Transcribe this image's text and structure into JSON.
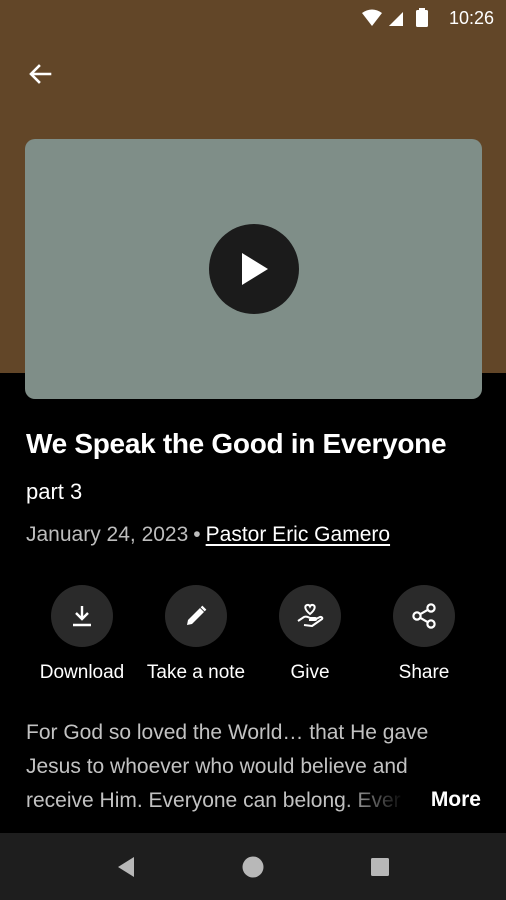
{
  "status_bar": {
    "time": "10:26",
    "icons": [
      "wifi-icon",
      "signal-icon",
      "battery-icon"
    ]
  },
  "header": {
    "back_icon": "arrow-left-icon"
  },
  "video": {
    "play_icon": "play-icon",
    "thumbnail_color": "#7f8e88"
  },
  "sermon": {
    "title": "We Speak the Good in Everyone",
    "subtitle": "part 3",
    "date": "January 24, 2023",
    "separator": "•",
    "author": "Pastor Eric Gamero"
  },
  "actions": [
    {
      "label": "Download",
      "icon": "download-icon"
    },
    {
      "label": "Take a note",
      "icon": "pencil-icon"
    },
    {
      "label": "Give",
      "icon": "give-hand-heart-icon"
    },
    {
      "label": "Share",
      "icon": "share-icon"
    }
  ],
  "description": {
    "text": "For God so loved the World… that He gave Jesus to whoever who would believe and receive Him. Everyone can belong. Ever",
    "more_label": "More"
  },
  "nav_bar": {
    "icons": [
      "back-triangle-icon",
      "home-circle-icon",
      "recents-square-icon"
    ]
  },
  "colors": {
    "hero_background": "#624628",
    "page_background": "#000000",
    "action_circle": "#2a2a2a",
    "nav_bar": "#1e1e1e"
  }
}
